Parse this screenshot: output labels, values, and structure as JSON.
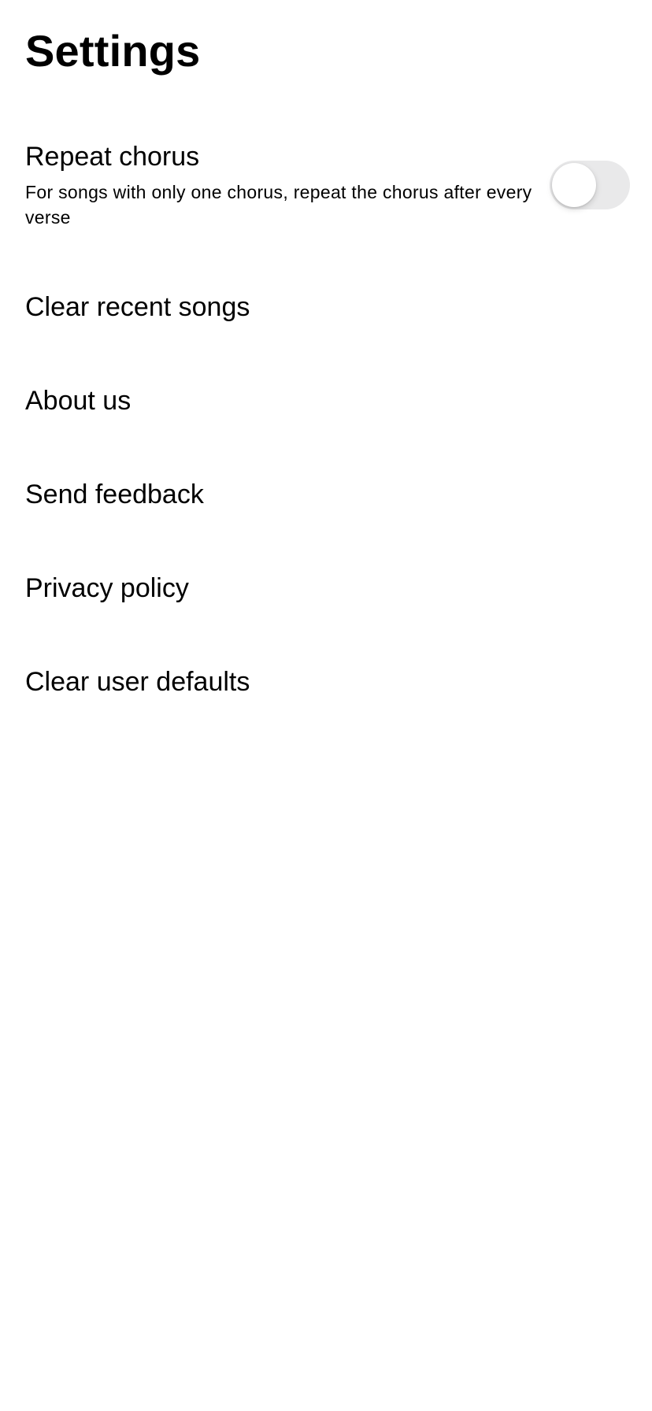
{
  "header": {
    "title": "Settings"
  },
  "settings": {
    "repeat_chorus": {
      "label": "Repeat chorus",
      "description": "For songs with only one chorus, repeat the chorus after every verse",
      "enabled": false
    },
    "items": [
      {
        "label": "Clear recent songs"
      },
      {
        "label": "About us"
      },
      {
        "label": "Send feedback"
      },
      {
        "label": "Privacy policy"
      },
      {
        "label": "Clear user defaults"
      }
    ]
  },
  "colors": {
    "background": "#ffffff",
    "text": "#000000",
    "toggle_off_track": "#e9e9ea"
  }
}
